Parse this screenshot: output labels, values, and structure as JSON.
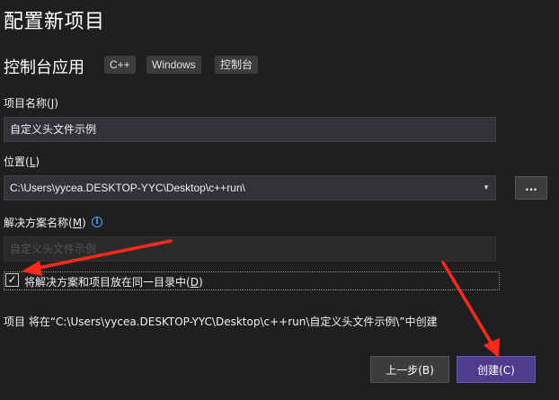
{
  "header": {
    "title": "配置新项目",
    "subtitle": "控制台应用",
    "tags": [
      "C++",
      "Windows",
      "控制台"
    ]
  },
  "project_name": {
    "label": "项目名称(",
    "hotkey": "J",
    "label_end": ")",
    "value": "自定义头文件示例"
  },
  "location": {
    "label": "位置(",
    "hotkey": "L",
    "label_end": ")",
    "value": "C:\\Users\\yycea.DESKTOP-YYC\\Desktop\\c++run\\",
    "browse_label": "..."
  },
  "solution_name": {
    "label": "解决方案名称(",
    "hotkey": "M",
    "label_end": ")",
    "value": "自定义头文件示例"
  },
  "same_dir": {
    "checked": true,
    "check_glyph": "✓",
    "label": "将解决方案和项目放在同一目录中(",
    "hotkey": "D",
    "label_end": ")"
  },
  "summary": "项目 将在“C:\\Users\\yycea.DESKTOP-YYC\\Desktop\\c++run\\自定义头文件示例\\”中创建",
  "buttons": {
    "back": "上一步(B)",
    "create": "创建(C)"
  },
  "colors": {
    "background": "#1f1f1f",
    "primary_button": "#4e3d8c",
    "annotation_arrow": "#ff2a1a",
    "info": "#4ea3ff"
  }
}
